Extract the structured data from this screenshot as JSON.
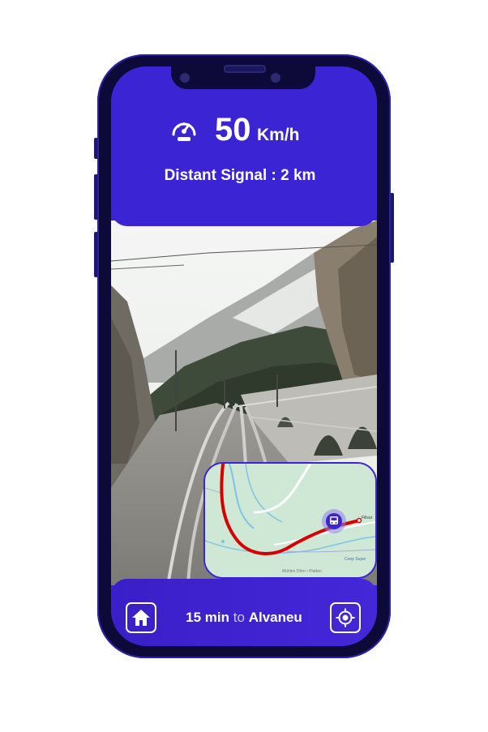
{
  "header": {
    "speed_value": "50",
    "speed_unit": "Km/h",
    "signal_text": "Distant Signal : 2 km"
  },
  "icons": {
    "speedometer": "speedometer-icon",
    "home": "home-icon",
    "locate": "locate-icon",
    "train": "train-icon"
  },
  "map": {
    "label_station": "Filisur",
    "label_small": "Coop Super",
    "label_bottom": "Mühlen Ofen • Platten"
  },
  "footer": {
    "duration": "15 min",
    "connector": "to",
    "destination": "Alvaneu"
  },
  "colors": {
    "accent": "#3b24d4",
    "route": "#d40000",
    "frame": "#0d0a3a"
  }
}
